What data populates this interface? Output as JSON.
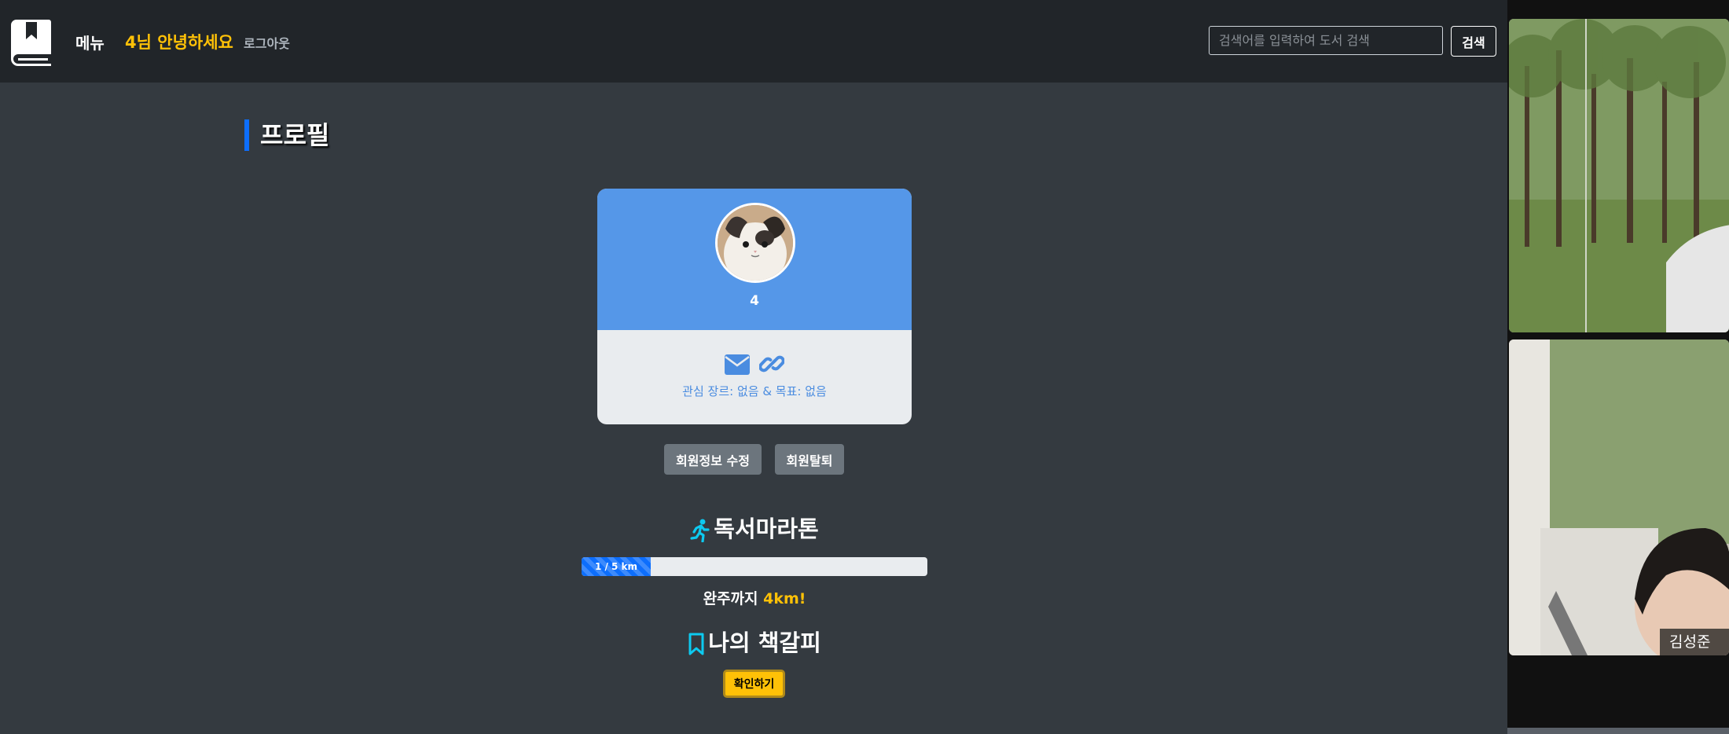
{
  "nav": {
    "menu_label": "메뉴",
    "greeting": "4님 안녕하세요",
    "logout_label": "로그아웃",
    "search_placeholder": "검색어를 입력하여 도서 검색",
    "search_button": "검색"
  },
  "page": {
    "title": "프로필"
  },
  "profile": {
    "username": "4",
    "info": "관심 장르: 없음 & 목표: 없음",
    "edit_button": "회원정보 수정",
    "withdraw_button": "회원탈퇴"
  },
  "marathon": {
    "title": "독서마라톤",
    "progress_label": "1 / 5 km",
    "progress_fraction": 0.2,
    "remain_prefix": "완주까지 ",
    "remain_value": "4km!"
  },
  "bookmark": {
    "title": "나의 책갈피",
    "confirm_button": "확인하기"
  },
  "video_call": {
    "participant_name": "김성준"
  },
  "icons": {
    "logo": "book-bookmark-icon",
    "mail": "envelope-icon",
    "link": "link-icon",
    "runner": "running-person-icon",
    "bookmark": "bookmark-icon"
  },
  "colors": {
    "navbar": "#212529",
    "background": "#343a40",
    "card_header": "#5597e8",
    "accent_yellow": "#ffc107",
    "accent_blue": "#0d6efd",
    "icon_cyan": "#0dcaf0"
  }
}
